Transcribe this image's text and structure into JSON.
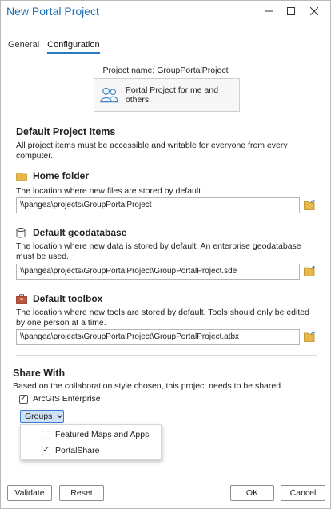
{
  "window": {
    "title": "New Portal Project",
    "minimize_glyph": "—",
    "maximize_glyph": "☐",
    "close_glyph": "✕"
  },
  "tabs": [
    {
      "label": "General",
      "active": false
    },
    {
      "label": "Configuration",
      "active": true
    }
  ],
  "project": {
    "name_line": "Project name: GroupPortalProject",
    "type_label": "Portal Project for me and others",
    "type_icon": "users-icon"
  },
  "default_items": {
    "heading": "Default Project Items",
    "description": "All project items must be accessible and writable for everyone from every computer.",
    "home_folder": {
      "heading": "Home folder",
      "icon": "folder-icon",
      "description": "The location where new files are stored by default.",
      "path": "\\\\pangea\\projects\\GroupPortalProject"
    },
    "geodatabase": {
      "heading": "Default geodatabase",
      "icon": "database-icon",
      "description": "The location where new data is stored by default. An enterprise geodatabase must be used.",
      "path": "\\\\pangea\\projects\\GroupPortalProject\\GroupPortalProject.sde"
    },
    "toolbox": {
      "heading": "Default toolbox",
      "icon": "toolbox-icon",
      "description": "The location where new tools are stored by default. Tools should only be edited by one person at a time.",
      "path": "\\\\pangea\\projects\\GroupPortalProject\\GroupPortalProject.atbx"
    }
  },
  "share": {
    "heading": "Share With",
    "description": "Based on the collaboration style chosen, this project needs to be shared.",
    "arcgis_enterprise": {
      "label": "ArcGIS Enterprise",
      "checked": true
    },
    "groups_button": "Groups",
    "group_options": [
      {
        "label": "Featured Maps and Apps",
        "checked": false
      },
      {
        "label": "PortalShare",
        "checked": true
      }
    ]
  },
  "buttons": {
    "validate": "Validate",
    "reset": "Reset",
    "ok": "OK",
    "cancel": "Cancel"
  },
  "colors": {
    "title_blue": "#1c6fb8",
    "tab_underline": "#2b78c5",
    "groups_bg": "#cfe2f6",
    "folder_yellow": "#e8b84a",
    "toolbox_red": "#c0533a"
  }
}
